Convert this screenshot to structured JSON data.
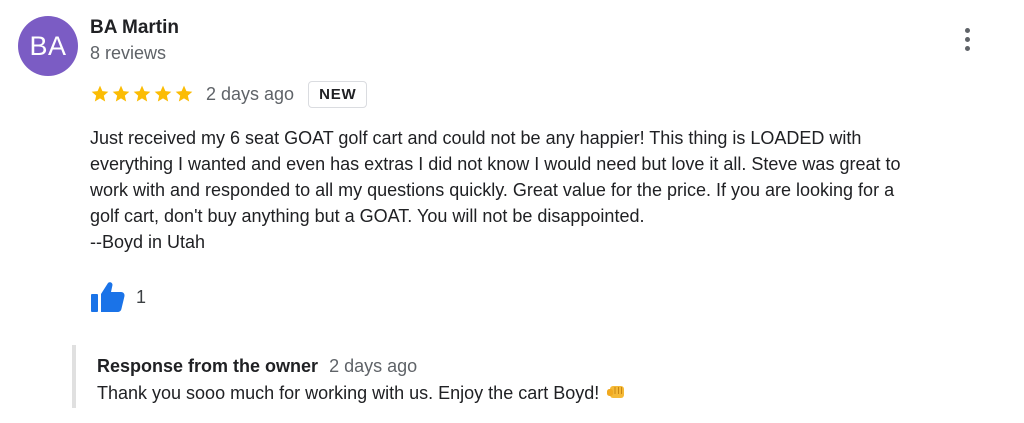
{
  "author": {
    "initials": "BA",
    "name": "BA Martin",
    "review_count": "8 reviews",
    "avatar_color": "#7b5cc4"
  },
  "rating": {
    "stars": 5,
    "max": 5,
    "star_color": "#fbbc04"
  },
  "date": "2 days ago",
  "badge": "NEW",
  "review_lines": [
    "Just received my 6 seat GOAT golf cart and could not be any happier!  This thing is LOADED with",
    "everything I wanted and even has extras I did not know I would need but love it all.  Steve was great to",
    "work with and responded to all my questions quickly.  Great value for the price.  If you are looking for a",
    "golf cart, don't buy anything but a GOAT. You will not be disappointed.",
    "--Boyd in Utah"
  ],
  "likes": {
    "count": "1",
    "icon": "thumbs-up-icon",
    "color": "#1a73e8"
  },
  "menu_icon": "more-vert-icon",
  "owner_response": {
    "title": "Response from the owner",
    "date": "2 days ago",
    "text": "Thank you sooo much for working with us. Enjoy the cart Boyd!",
    "emoji_icon": "fist-bump-icon"
  }
}
